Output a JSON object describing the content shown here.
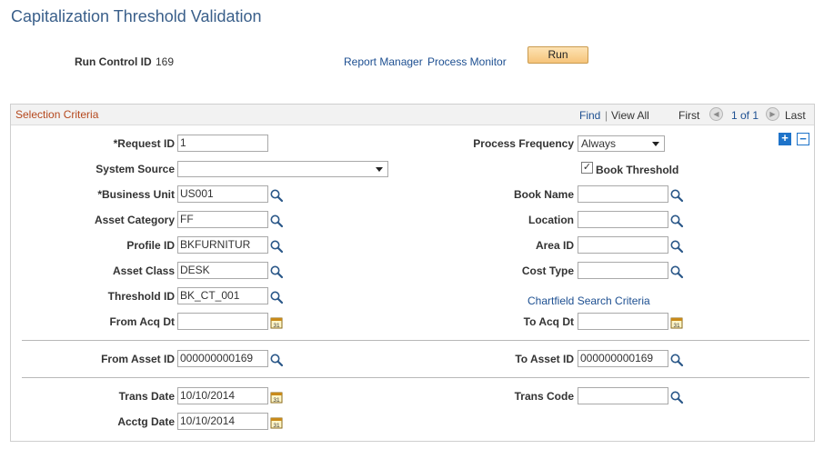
{
  "page": {
    "title": "Capitalization Threshold Validation"
  },
  "header": {
    "run_control_label": "Run Control ID",
    "run_control_value": "169",
    "report_manager_link": "Report Manager",
    "process_monitor_link": "Process Monitor",
    "run_button": "Run"
  },
  "panel": {
    "title": "Selection Criteria",
    "find": "Find",
    "separator": "|",
    "view_all": "View All",
    "first": "First",
    "page_info": "1 of 1",
    "last": "Last",
    "add_icon": "+",
    "remove_icon": "−"
  },
  "form": {
    "request_id": {
      "label": "*Request ID",
      "value": "1"
    },
    "system_source": {
      "label": "System Source",
      "value": ""
    },
    "business_unit": {
      "label": "*Business Unit",
      "value": "US001"
    },
    "asset_category": {
      "label": "Asset Category",
      "value": "FF"
    },
    "profile_id": {
      "label": "Profile ID",
      "value": "BKFURNITUR"
    },
    "asset_class": {
      "label": "Asset Class",
      "value": "DESK"
    },
    "threshold_id": {
      "label": "Threshold ID",
      "value": "BK_CT_001"
    },
    "from_acq_dt": {
      "label": "From Acq Dt",
      "value": ""
    },
    "process_frequency": {
      "label": "Process Frequency",
      "value": "Always"
    },
    "book_threshold": {
      "label": "Book Threshold",
      "checked": true
    },
    "book_name": {
      "label": "Book Name",
      "value": ""
    },
    "location": {
      "label": "Location",
      "value": ""
    },
    "area_id": {
      "label": "Area ID",
      "value": ""
    },
    "cost_type": {
      "label": "Cost Type",
      "value": ""
    },
    "chartfield_link": "Chartfield Search Criteria",
    "to_acq_dt": {
      "label": "To Acq Dt",
      "value": ""
    },
    "from_asset_id": {
      "label": "From Asset ID",
      "value": "000000000169"
    },
    "to_asset_id": {
      "label": "To Asset ID",
      "value": "000000000169"
    },
    "trans_date": {
      "label": "Trans Date",
      "value": "10/10/2014"
    },
    "trans_code": {
      "label": "Trans Code",
      "value": ""
    },
    "acctg_date": {
      "label": "Acctg Date",
      "value": "10/10/2014"
    }
  },
  "icons": {
    "lookup": "search-icon",
    "calendar": "calendar-icon",
    "calendar_text": "31",
    "nav_prev": "◀",
    "nav_next": "▶",
    "check": "✓"
  },
  "colors": {
    "title": "#3a5f8a",
    "link": "#1d4f91",
    "section_title": "#b5481d",
    "run_button": "#f6c47a"
  }
}
